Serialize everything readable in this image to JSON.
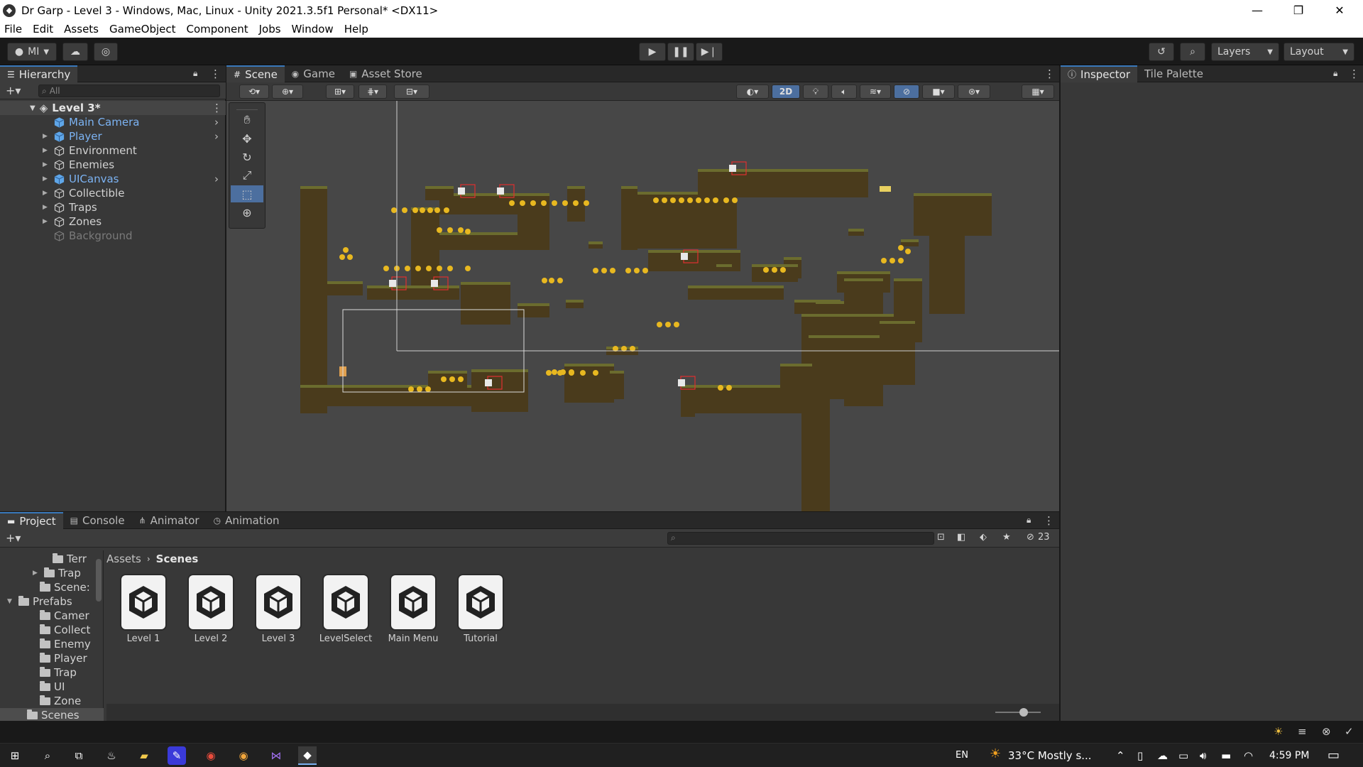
{
  "window": {
    "title": "Dr Garp - Level 3 - Windows, Mac, Linux - Unity 2021.3.5f1 Personal* <DX11>",
    "minimize": "—",
    "restore": "❐",
    "close": "✕"
  },
  "menu": [
    "File",
    "Edit",
    "Assets",
    "GameObject",
    "Component",
    "Jobs",
    "Window",
    "Help"
  ],
  "toolbar": {
    "account": "MI",
    "layers": "Layers",
    "layout": "Layout"
  },
  "hierarchy": {
    "tab": "Hierarchy",
    "search_placeholder": "All",
    "scene": "Level 3*",
    "items": [
      {
        "label": "Main Camera",
        "prefab": true
      },
      {
        "label": "Player",
        "prefab": true
      },
      {
        "label": "Environment",
        "prefab": false
      },
      {
        "label": "Enemies",
        "prefab": false
      },
      {
        "label": "UICanvas",
        "prefab": true
      },
      {
        "label": "Collectible",
        "prefab": false
      },
      {
        "label": "Traps",
        "prefab": false
      },
      {
        "label": "Zones",
        "prefab": false
      },
      {
        "label": "Background",
        "prefab": false,
        "disabled": true
      }
    ]
  },
  "scene_tabs": [
    "Scene",
    "Game",
    "Asset Store"
  ],
  "scene_toolbar": {
    "mode_2d": "2D"
  },
  "inspector_tabs": [
    "Inspector",
    "Tile Palette"
  ],
  "bottom_tabs": [
    "Project",
    "Console",
    "Animator",
    "Animation"
  ],
  "project": {
    "breadcrumb": [
      "Assets",
      "Scenes"
    ],
    "hidden_count": "23",
    "tree": [
      {
        "label": "Terr"
      },
      {
        "label": "Trap"
      },
      {
        "label": "Scene:"
      },
      {
        "label": "Prefabs"
      },
      {
        "label": "Camer"
      },
      {
        "label": "Collect"
      },
      {
        "label": "Enemy"
      },
      {
        "label": "Player"
      },
      {
        "label": "Trap"
      },
      {
        "label": "UI"
      },
      {
        "label": "Zone"
      },
      {
        "label": "Scenes"
      }
    ],
    "assets": [
      "Level 1",
      "Level 2",
      "Level 3",
      "LevelSelect",
      "Main Menu",
      "Tutorial"
    ]
  },
  "taskbar": {
    "lang": "EN",
    "weather": "33°C Mostly s...",
    "time": "4:59 PM"
  },
  "colors": {
    "accent": "#3a79bb",
    "prefab_text": "#7cb3f3",
    "dirt": "#4a3b1c",
    "grass": "#6b6c2e",
    "coin": "#e8b820"
  }
}
